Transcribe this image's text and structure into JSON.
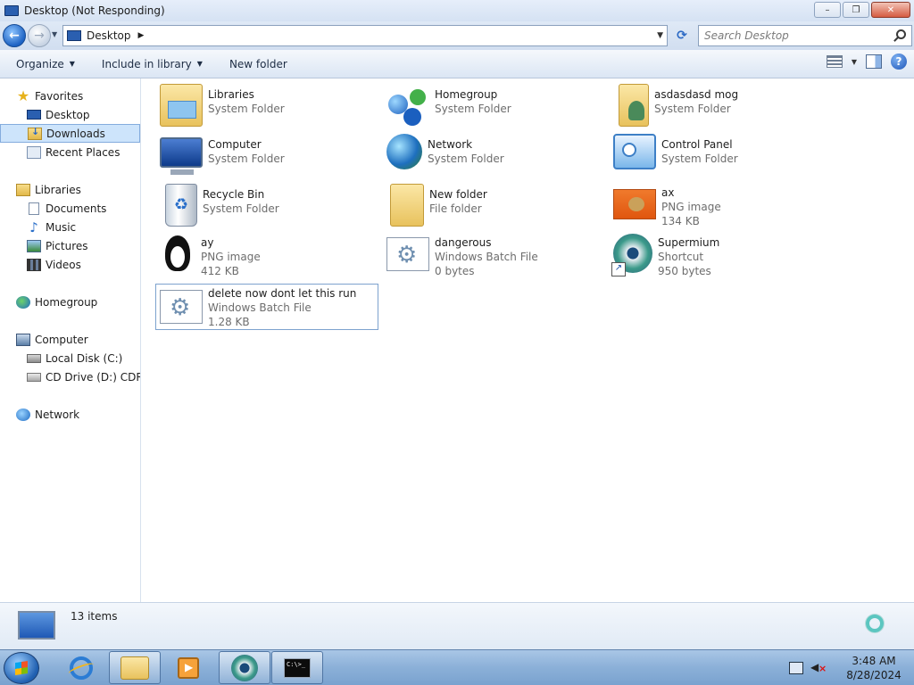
{
  "window": {
    "title": "Desktop (Not Responding)",
    "controls": {
      "minimize": "–",
      "maximize": "❐",
      "close": "✕"
    }
  },
  "address_bar": {
    "back_label": "←",
    "forward_label": "→",
    "location": "Desktop",
    "crumb_arrow": "▶",
    "dropdown_arrow": "▼",
    "refresh_label": "⟳",
    "search_placeholder": "Search Desktop"
  },
  "toolbar": {
    "organize": "Organize",
    "include_in_library": "Include in library",
    "new_folder": "New folder",
    "caret": "▼",
    "help": "?"
  },
  "sidebar": {
    "favorites": {
      "label": "Favorites",
      "items": [
        "Desktop",
        "Downloads",
        "Recent Places"
      ]
    },
    "libraries": {
      "label": "Libraries",
      "items": [
        "Documents",
        "Music",
        "Pictures",
        "Videos"
      ]
    },
    "homegroup": "Homegroup",
    "computer": {
      "label": "Computer",
      "items": [
        "Local Disk (C:)",
        "CD Drive (D:) CDROM"
      ]
    },
    "network": "Network",
    "selected": "Downloads"
  },
  "files": [
    {
      "name": "Libraries",
      "type": "System Folder",
      "size": "",
      "icon": "libraries-icon"
    },
    {
      "name": "Homegroup",
      "type": "System Folder",
      "size": "",
      "icon": "homegroup-icon"
    },
    {
      "name": "asdasdasd mog",
      "type": "System Folder",
      "size": "",
      "icon": "user-folder-icon"
    },
    {
      "name": "Computer",
      "type": "System Folder",
      "size": "",
      "icon": "computer-icon"
    },
    {
      "name": "Network",
      "type": "System Folder",
      "size": "",
      "icon": "network-icon"
    },
    {
      "name": "Control Panel",
      "type": "System Folder",
      "size": "",
      "icon": "control-panel-icon"
    },
    {
      "name": "Recycle Bin",
      "type": "System Folder",
      "size": "",
      "icon": "recycle-bin-icon"
    },
    {
      "name": "New folder",
      "type": "File folder",
      "size": "",
      "icon": "folder-icon"
    },
    {
      "name": "ax",
      "type": "PNG image",
      "size": "134 KB",
      "icon": "png-image-icon"
    },
    {
      "name": "ay",
      "type": "PNG image",
      "size": "412 KB",
      "icon": "tux-image-icon"
    },
    {
      "name": "dangerous",
      "type": "Windows Batch File",
      "size": "0 bytes",
      "icon": "batch-file-icon"
    },
    {
      "name": "Supermium",
      "type": "Shortcut",
      "size": "950 bytes",
      "icon": "supermium-shortcut-icon"
    },
    {
      "name": "delete now dont let this run",
      "type": "Windows Batch File",
      "size": "1.28 KB",
      "icon": "batch-file-icon"
    }
  ],
  "status": {
    "item_count": "13 items"
  },
  "taskbar": {
    "pinned": [
      "Internet Explorer",
      "Windows Explorer",
      "Windows Media Player",
      "Supermium",
      "Command Prompt"
    ],
    "cmd_text": "C:\\>_",
    "time": "3:48 AM",
    "date": "8/28/2024"
  }
}
